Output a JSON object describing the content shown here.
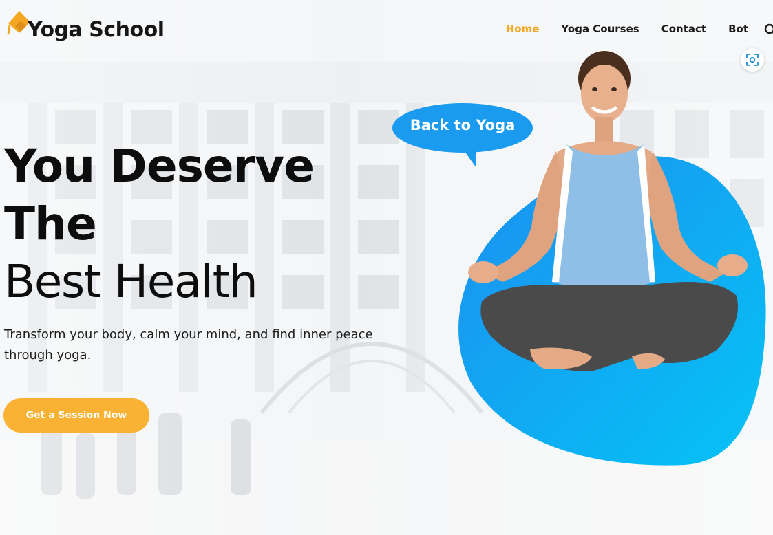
{
  "brand": {
    "name": "Yoga School",
    "accent": "#f5a623",
    "blue": "#1aa0f0"
  },
  "nav": {
    "items": [
      {
        "label": "Home",
        "active": true
      },
      {
        "label": "Yoga Courses",
        "active": false
      },
      {
        "label": "Contact",
        "active": false
      },
      {
        "label": "Bot",
        "active": false
      }
    ],
    "search_icon": "search-icon"
  },
  "floating_button": {
    "icon": "scan-icon"
  },
  "hero": {
    "line1": "You Deserve",
    "line2": "The",
    "line3": "Best Health",
    "subtitle": "Transform your body, calm your mind, and find inner peace through yoga.",
    "cta_label": "Get a Session Now"
  },
  "illustration": {
    "bubble_text": "Back to Yoga"
  }
}
